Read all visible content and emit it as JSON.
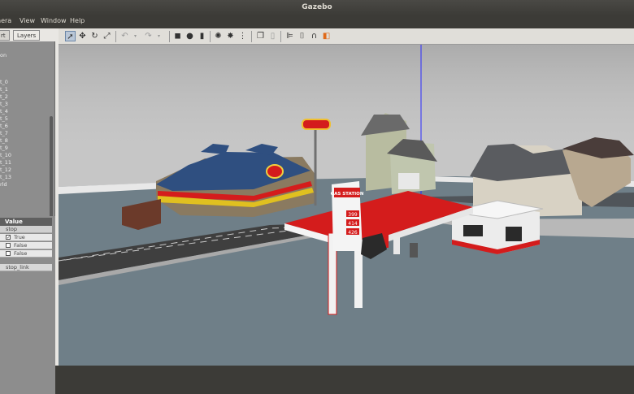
{
  "window": {
    "title": "Gazebo"
  },
  "menu": {
    "items": [
      "nera",
      "View",
      "Window",
      "Help"
    ]
  },
  "left_panel": {
    "tabs": [
      "rt",
      "Layers"
    ],
    "tree_items": [
      "on",
      "t_0",
      "t_1",
      "t_2",
      "t_3",
      "t_4",
      "t_5",
      "t_6",
      "t_7",
      "t_8",
      "t_9",
      "t_10",
      "t_11",
      "t_12",
      "t_13",
      "rld"
    ],
    "properties": {
      "header": "Value",
      "rows": [
        {
          "label": "stop",
          "checked": null
        },
        {
          "label": "True",
          "checked": true
        },
        {
          "label": "False",
          "checked": false
        },
        {
          "label": "False",
          "checked": false
        }
      ],
      "link_label": "stop_link"
    }
  },
  "toolbar": {
    "icons": [
      "select-arrow-icon",
      "translate-icon",
      "rotate-icon",
      "scale-icon",
      "undo-icon",
      "undo-dropdown-icon",
      "redo-icon",
      "redo-dropdown-icon",
      "box-icon",
      "sphere-icon",
      "cylinder-icon",
      "point-light-icon",
      "spot-light-icon",
      "directional-light-icon",
      "copy-icon",
      "paste-icon",
      "align-icon",
      "snap-icon",
      "joint-icon",
      "record-icon"
    ]
  },
  "scene": {
    "sign_text": "GAS STATION",
    "prices": [
      "399",
      "414",
      "426"
    ],
    "colors": {
      "sky": "#c6c6c6",
      "ground": "#6f7f88",
      "road": "#3f3f3f",
      "accent_red": "#d41c1c"
    }
  }
}
